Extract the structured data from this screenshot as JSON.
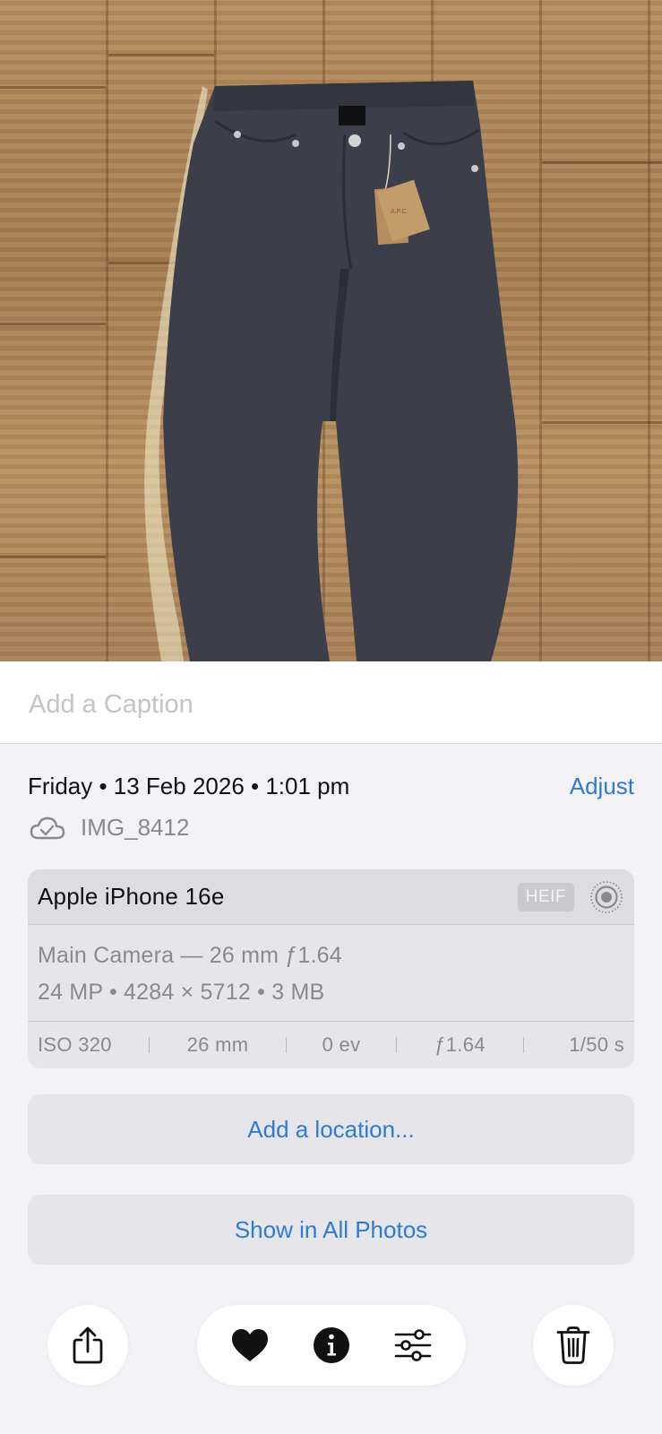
{
  "caption": {
    "placeholder": "Add a Caption"
  },
  "info": {
    "date": "Friday • 13 Feb 2026 • 1:01 pm",
    "adjust_label": "Adjust",
    "file_name": "IMG_8412"
  },
  "camera": {
    "model": "Apple iPhone 16e",
    "format_badge": "HEIF",
    "lens": "Main Camera — 26 mm ƒ1.64",
    "specs": "24 MP • 4284 × 5712 • 3 MB",
    "exif": {
      "iso": "ISO 320",
      "focal_length": "26 mm",
      "exposure": "0 ev",
      "aperture": "ƒ1.64",
      "shutter": "1/50 s"
    }
  },
  "actions": {
    "add_location": "Add a location...",
    "show_in_all_photos": "Show in All Photos"
  },
  "photo": {
    "tag_brand": "A.P.C."
  },
  "toolbar": {
    "icons": [
      "share-icon",
      "heart-icon",
      "info-icon",
      "adjustments-icon",
      "trash-icon"
    ]
  },
  "colors": {
    "accent": "#2f7bd4",
    "background": "#f2f2f7",
    "card": "#e5e5ea"
  }
}
